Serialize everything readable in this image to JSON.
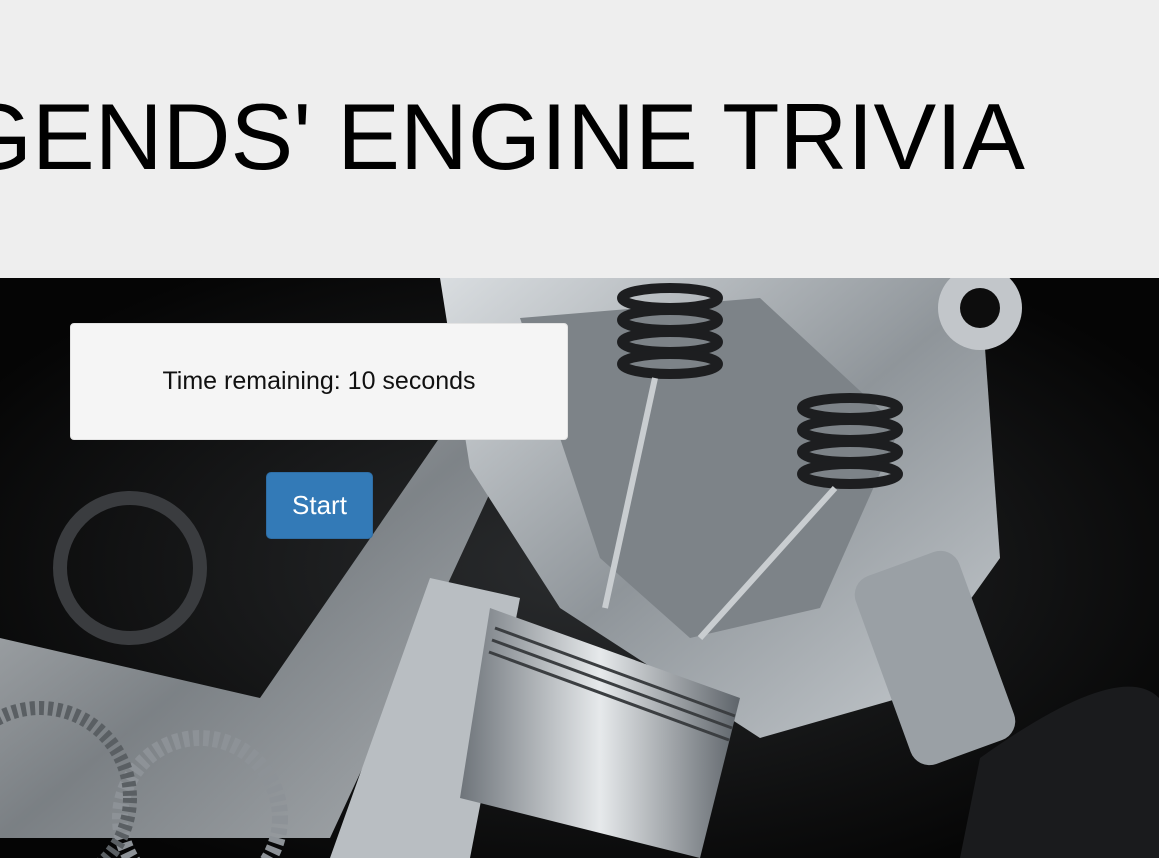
{
  "header": {
    "title": "LEGENDS' ENGINE TRIVIA"
  },
  "timer": {
    "label": "Time remaining: 10 seconds"
  },
  "controls": {
    "start_label": "Start"
  },
  "background": {
    "image_name": "engine-cutaway-image",
    "tone": "#050505"
  },
  "colors": {
    "jumbotron": "#eeeeee",
    "button": "#337ab7",
    "well": "#f5f5f5"
  }
}
